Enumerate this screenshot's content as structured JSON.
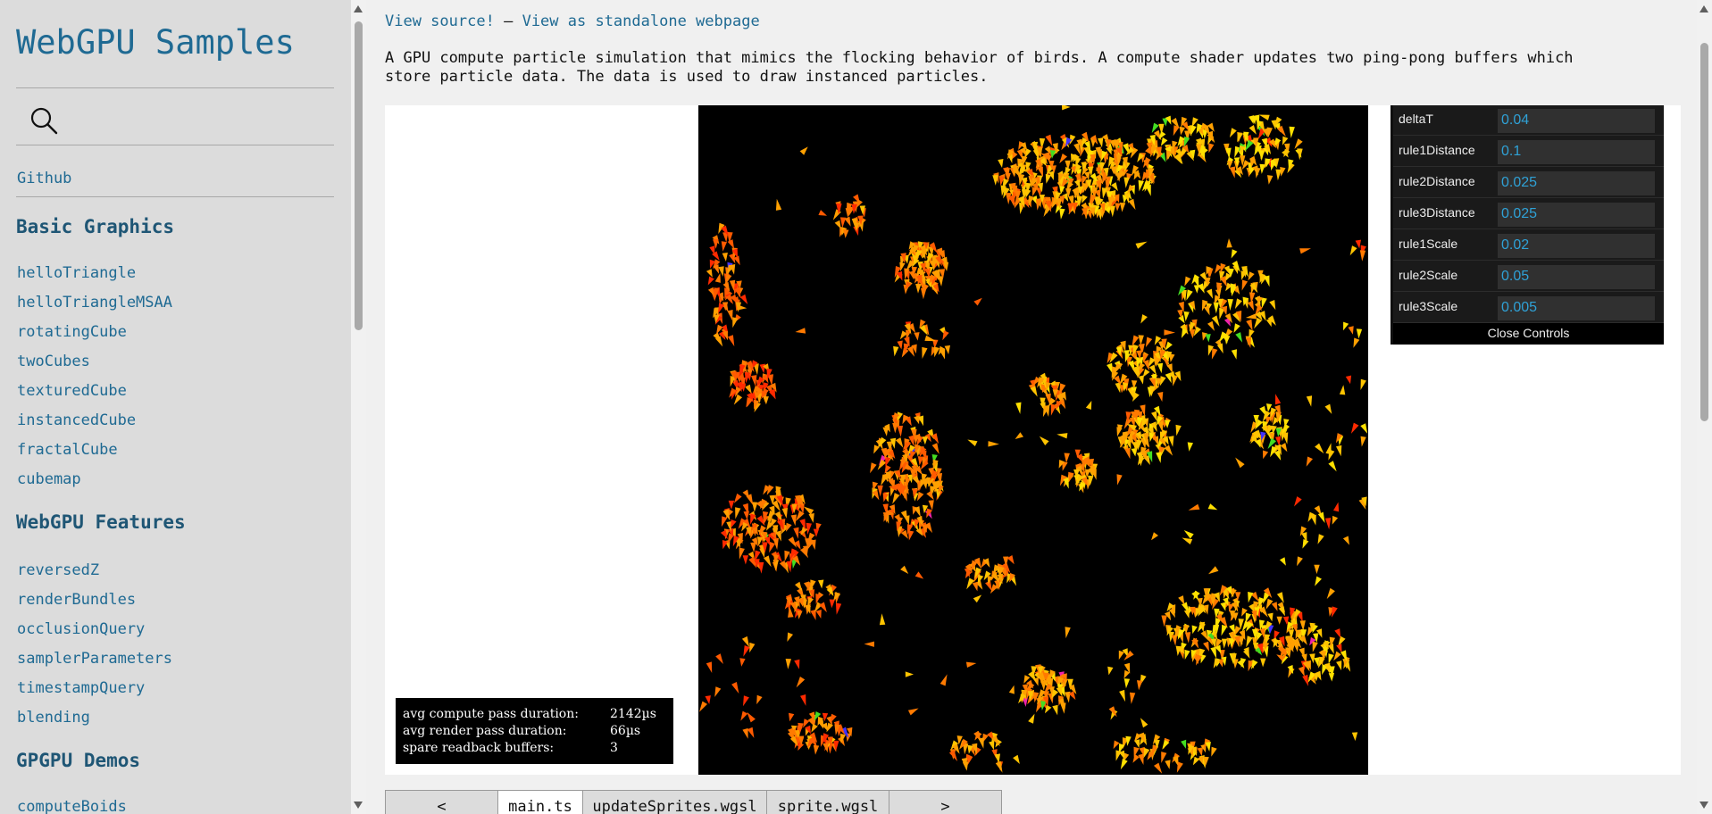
{
  "sidebar": {
    "title": "WebGPU Samples",
    "github_label": "Github",
    "sections": [
      {
        "heading": "Basic Graphics",
        "items": [
          "helloTriangle",
          "helloTriangleMSAA",
          "rotatingCube",
          "twoCubes",
          "texturedCube",
          "instancedCube",
          "fractalCube",
          "cubemap"
        ]
      },
      {
        "heading": "WebGPU Features",
        "items": [
          "reversedZ",
          "renderBundles",
          "occlusionQuery",
          "samplerParameters",
          "timestampQuery",
          "blending"
        ]
      },
      {
        "heading": "GPGPU Demos",
        "items": [
          "computeBoids"
        ]
      }
    ]
  },
  "main": {
    "view_source_label": "View source!",
    "separator": "—",
    "standalone_label": "View as standalone webpage",
    "description": "A GPU compute particle simulation that mimics the flocking behavior of birds. A compute shader updates two ping-pong buffers which store particle data. The data is used to draw instanced particles.",
    "stats": [
      {
        "label": "avg compute pass duration:",
        "value": "2142µs"
      },
      {
        "label": "avg render pass duration:",
        "value": "66µs"
      },
      {
        "label": "spare readback buffers:",
        "value": "3"
      }
    ],
    "controls": [
      {
        "label": "deltaT",
        "value": "0.04"
      },
      {
        "label": "rule1Distance",
        "value": "0.1"
      },
      {
        "label": "rule2Distance",
        "value": "0.025"
      },
      {
        "label": "rule3Distance",
        "value": "0.025"
      },
      {
        "label": "rule1Scale",
        "value": "0.02"
      },
      {
        "label": "rule2Scale",
        "value": "0.05"
      },
      {
        "label": "rule3Scale",
        "value": "0.005"
      }
    ],
    "close_controls_label": "Close Controls",
    "tabs": [
      "<",
      "main.ts",
      "updateSprites.wgsl",
      "sprite.wgsl",
      ">"
    ],
    "active_tab": "main.ts"
  },
  "colors": {
    "link": "#1f6a93",
    "sidebar_bg": "#dcdcdc",
    "main_bg": "#f0f0f0",
    "gui_value": "#2fa1d6",
    "canvas_bg": "#000000"
  },
  "icons": {
    "search": "search-icon"
  }
}
